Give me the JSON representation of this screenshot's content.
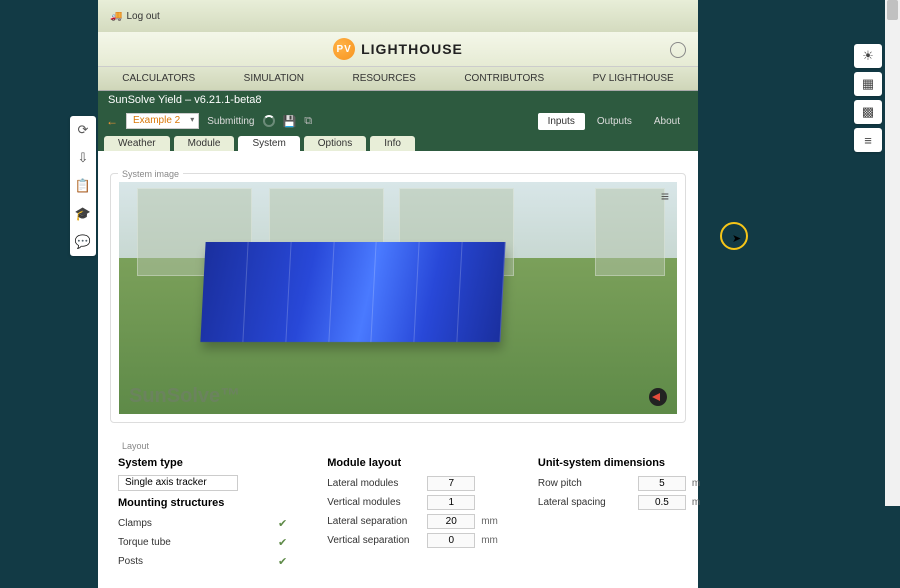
{
  "top": {
    "logout": "Log out"
  },
  "brand": {
    "pv": "PV",
    "name": "LIGHTHOUSE"
  },
  "nav": {
    "calc": "CALCULATORS",
    "sim": "SIMULATION",
    "res": "RESOURCES",
    "contrib": "CONTRIBUTORS",
    "pvl": "PV LIGHTHOUSE"
  },
  "sub": {
    "title": "SunSolve Yield – v6.21.1-beta8",
    "example": "Example 2",
    "status": "Submitting"
  },
  "rtabs": {
    "inputs": "Inputs",
    "outputs": "Outputs",
    "about": "About"
  },
  "stabs": {
    "weather": "Weather",
    "module": "Module",
    "system": "System",
    "options": "Options",
    "info": "Info"
  },
  "fieldset": {
    "image": "System image",
    "layout": "Layout"
  },
  "watermark": "SunSolve™",
  "layout": {
    "col1": {
      "title": "System type",
      "sel": "Single axis tracker",
      "subtitle": "Mounting structures",
      "rows": [
        "Clamps",
        "Torque tube",
        "Posts"
      ]
    },
    "col2": {
      "title": "Module layout",
      "r1": {
        "label": "Lateral modules",
        "val": "7"
      },
      "r2": {
        "label": "Vertical modules",
        "val": "1"
      },
      "r3": {
        "label": "Lateral separation",
        "val": "20",
        "unit": "mm"
      },
      "r4": {
        "label": "Vertical separation",
        "val": "0",
        "unit": "mm"
      }
    },
    "col3": {
      "title": "Unit-system dimensions",
      "r1": {
        "label": "Row pitch",
        "val": "5",
        "unit": "m"
      },
      "r2": {
        "label": "Lateral spacing",
        "val": "0.5",
        "unit": "m"
      }
    }
  }
}
